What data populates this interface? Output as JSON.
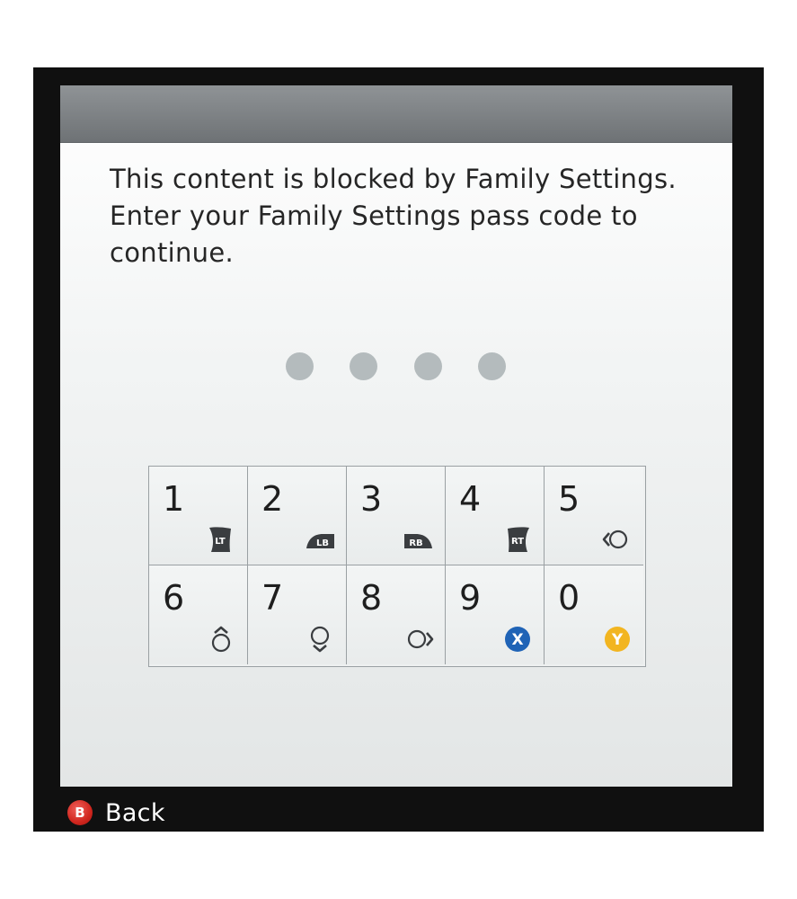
{
  "dialog": {
    "message": "This content is blocked by Family Settings. Enter your Family Settings pass code to continue.",
    "passcode_slots": 4,
    "passcode_filled": 0
  },
  "keypad": {
    "keys": [
      {
        "digit": "1",
        "controller_button": "LT",
        "icon": "left-trigger-icon"
      },
      {
        "digit": "2",
        "controller_button": "LB",
        "icon": "left-bumper-icon"
      },
      {
        "digit": "3",
        "controller_button": "RB",
        "icon": "right-bumper-icon"
      },
      {
        "digit": "4",
        "controller_button": "RT",
        "icon": "right-trigger-icon"
      },
      {
        "digit": "5",
        "controller_button": "",
        "icon": "dpad-left-icon"
      },
      {
        "digit": "6",
        "controller_button": "",
        "icon": "dpad-up-icon"
      },
      {
        "digit": "7",
        "controller_button": "",
        "icon": "dpad-down-icon"
      },
      {
        "digit": "8",
        "controller_button": "",
        "icon": "dpad-right-icon"
      },
      {
        "digit": "9",
        "controller_button": "X",
        "icon": "x-button-icon"
      },
      {
        "digit": "0",
        "controller_button": "Y",
        "icon": "y-button-icon"
      }
    ]
  },
  "footer": {
    "back_button_glyph": "B",
    "back_label": "Back"
  },
  "colors": {
    "x_button": "#1f63b6",
    "y_button": "#f2b520",
    "b_button": "#d0261e",
    "shoulder_button": "#3a3d40",
    "passcode_dot": "#b4bbbd"
  }
}
